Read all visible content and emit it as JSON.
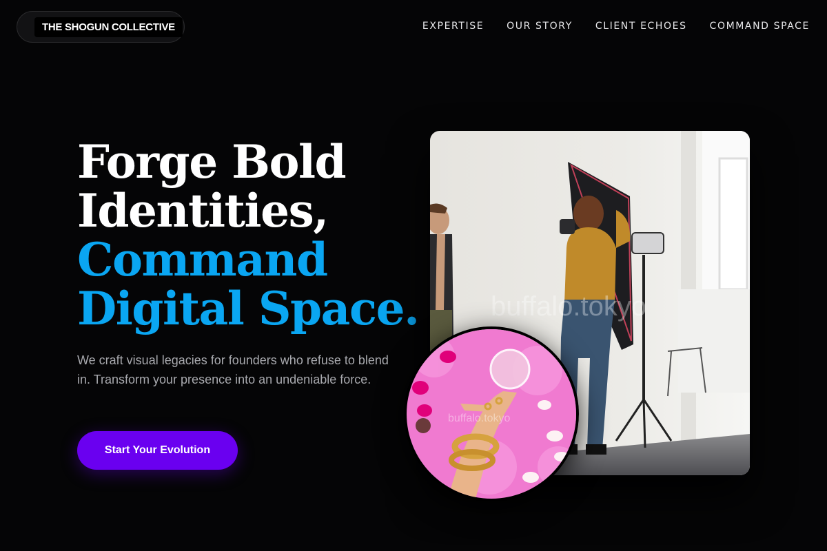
{
  "brand": {
    "name": "THE SHOGUN COLLECTIVE"
  },
  "nav": {
    "items": [
      {
        "label": "EXPERTISE"
      },
      {
        "label": "OUR STORY"
      },
      {
        "label": "CLIENT ECHOES"
      },
      {
        "label": "COMMAND SPACE"
      }
    ]
  },
  "hero": {
    "title_line1": "Forge Bold",
    "title_line2": "Identities,",
    "title_line3": "Command",
    "title_line4": "Digital Space.",
    "subtitle": "We craft visual legacies for founders who refuse to blend in. Transform your presence into an undeniable force.",
    "cta_label": "Start Your Evolution"
  },
  "media": {
    "main_photo_watermark": "buffalo.tokyo",
    "circle_photo_watermark": "buffalo.tokyo"
  },
  "colors": {
    "background": "#050506",
    "accent_blue": "#0aa6f2",
    "cta_purple": "#6a00f0",
    "subtitle_gray": "#a8a9ae"
  }
}
